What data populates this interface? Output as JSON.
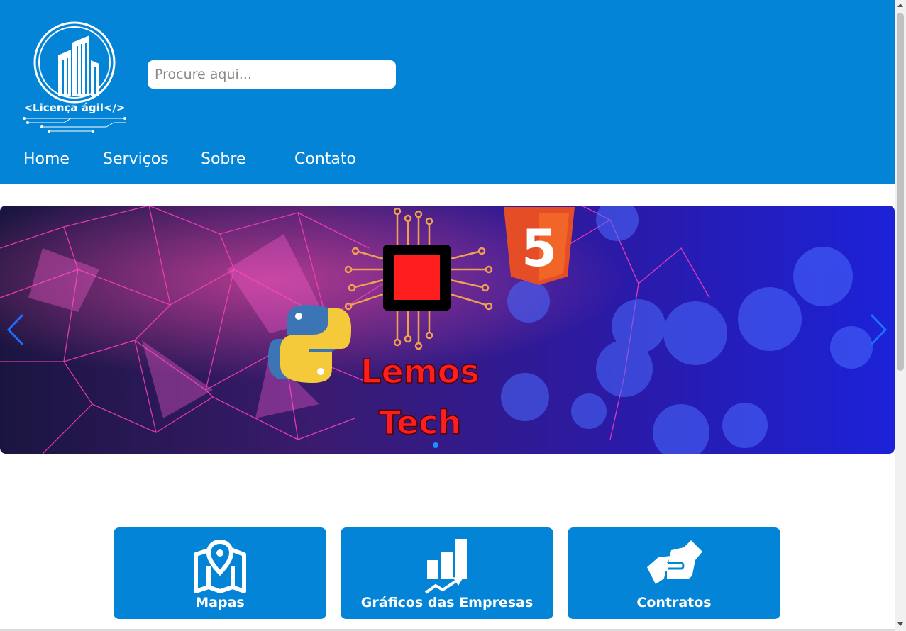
{
  "header": {
    "logo_text": "<Licença ágil</>",
    "search_placeholder": "Procure aqui..."
  },
  "nav": {
    "items": [
      {
        "label": "Home"
      },
      {
        "label": "Serviços"
      },
      {
        "label": "Sobre"
      },
      {
        "label": "Contato"
      }
    ]
  },
  "carousel": {
    "slide_title_line1": "Lemos",
    "slide_title_line2": "Tech",
    "html_badge": "5"
  },
  "cards": [
    {
      "label": "Mapas",
      "icon": "map-icon"
    },
    {
      "label": "Gráficos das Empresas",
      "icon": "chart-icon"
    },
    {
      "label": "Contratos",
      "icon": "handshake-icon"
    }
  ],
  "colors": {
    "brand_blue": "#0384d6",
    "text_white": "#ffffff",
    "slide_text_red": "#ff1e1e"
  }
}
